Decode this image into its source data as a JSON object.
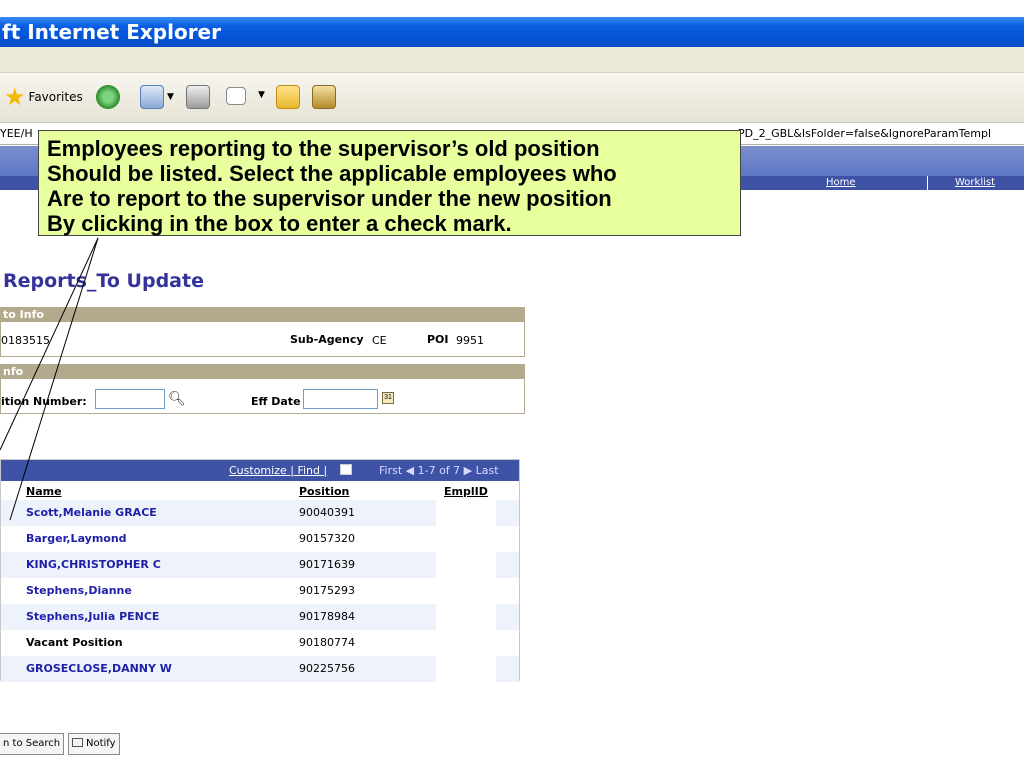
{
  "window": {
    "title": "ft Internet Explorer"
  },
  "toolbar": {
    "favorites_label": "Favorites"
  },
  "address": {
    "left_fragment": "YEE/H",
    "right_fragment": "PD_2_GBL&IsFolder=false&IgnoreParamTempl"
  },
  "nav": {
    "home_label": "Home",
    "worklist_label": "Worklist"
  },
  "callout": {
    "lines": [
      "Employees reporting to the supervisor’s old position",
      "Should be listed.   Select the applicable employees who",
      "Are to report to the supervisor under the new position",
      "By clicking in the box to enter a check mark."
    ]
  },
  "page": {
    "title": "Reports_To Update"
  },
  "section1": {
    "header": "to Info",
    "id_value": "0183515",
    "sub_agency_label": "Sub-Agency",
    "sub_agency_value": "CE",
    "poi_label": "POI",
    "poi_value": "9951"
  },
  "section2": {
    "header": "nfo",
    "position_number_label": "ition Number:",
    "eff_date_label": "Eff Date",
    "position_number_value": "",
    "eff_date_value": ""
  },
  "grid": {
    "header_links": "Customize | Find | ",
    "nav_text": "First ◀ 1-7 of 7 ▶ Last",
    "columns": {
      "name": "Name",
      "position": "Position",
      "emplid": "EmplID"
    },
    "rows": [
      {
        "name": "Scott,Melanie GRACE",
        "position": "90040391",
        "emplid": ""
      },
      {
        "name": "Barger,Laymond",
        "position": "90157320",
        "emplid": ""
      },
      {
        "name": "KING,CHRISTOPHER C",
        "position": "90171639",
        "emplid": ""
      },
      {
        "name": "Stephens,Dianne",
        "position": "90175293",
        "emplid": ""
      },
      {
        "name": "Stephens,Julia PENCE",
        "position": "90178984",
        "emplid": ""
      },
      {
        "name": "Vacant Position",
        "position": "90180774",
        "emplid": ""
      },
      {
        "name": "GROSECLOSE,DANNY W",
        "position": "90225756",
        "emplid": ""
      }
    ]
  },
  "buttons": {
    "return_label": "n to Search",
    "notify_label": "Notify"
  },
  "colors": {
    "title_blue": "#0454d8",
    "callout_bg": "#e7ff9c",
    "grid_header": "#3f53a6",
    "section_header": "#b3a98c",
    "link_blue": "#1f1fa8"
  }
}
